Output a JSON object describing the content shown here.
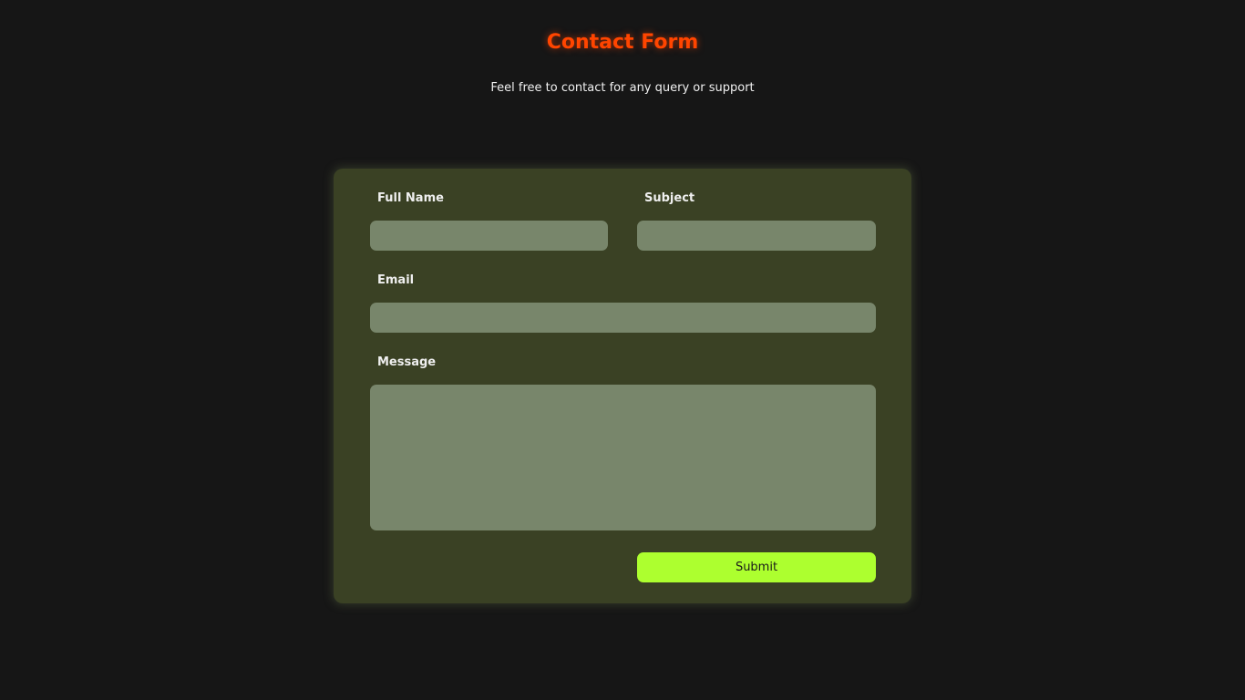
{
  "header": {
    "title": "Contact Form",
    "subtitle": "Feel free to contact for any query or support"
  },
  "form": {
    "full_name": {
      "label": "Full Name",
      "value": "",
      "placeholder": ""
    },
    "subject": {
      "label": "Subject",
      "value": "",
      "placeholder": ""
    },
    "email": {
      "label": "Email",
      "value": "",
      "placeholder": ""
    },
    "message": {
      "label": "Message",
      "value": "",
      "placeholder": ""
    },
    "submit_label": "Submit"
  },
  "colors": {
    "background": "#161616",
    "title": "#ff4500",
    "card": "#3a4124",
    "field": "#78866b",
    "submit": "#adff2f"
  }
}
